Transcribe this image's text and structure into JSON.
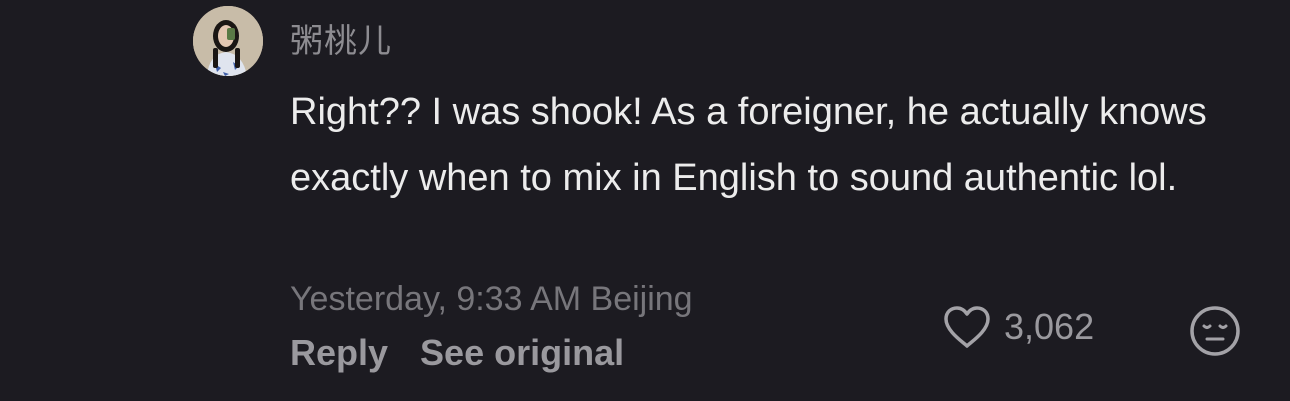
{
  "comment": {
    "username": "粥桃儿",
    "text": "Right?? I was shook! As a foreigner, he actually knows exactly when to mix in English to sound authentic lol.",
    "timestamp": "Yesterday, 9:33 AM Beijing",
    "actions": {
      "reply_label": "Reply",
      "see_original_label": "See original"
    },
    "likes": {
      "count": "3,062",
      "icon": "heart-outline-icon"
    },
    "reaction_icon": "emoji-face-icon",
    "avatar_icon": "user-avatar"
  },
  "colors": {
    "background": "#1c1b21",
    "text_primary": "#ececec",
    "text_secondary": "#8d8c91",
    "text_muted": "#77767b"
  }
}
